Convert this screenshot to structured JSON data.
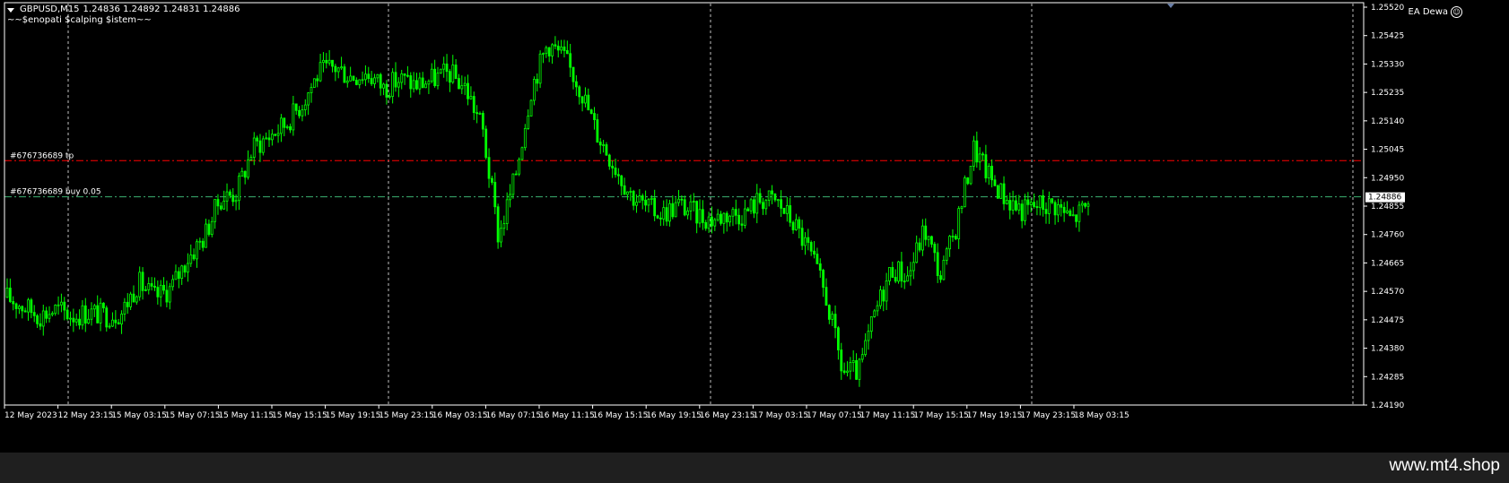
{
  "header": {
    "symbol": "GBPUSD,M15",
    "ohlc": "1.24836 1.24892 1.24831 1.24886",
    "indicator": "~~$enopati $calping $istem~~"
  },
  "ea_label": "EA Dewa",
  "watermark": "www.mt4.shop",
  "orders": {
    "tp_label": "#676736689 tp",
    "tp_price": 1.25007,
    "buy_label": "#676736689 buy 0.05",
    "buy_price": 1.24886
  },
  "colors": {
    "background": "#000000",
    "candles": "#00ff00",
    "tp_line": "#ff0000",
    "order_line": "#3cb371",
    "grid": "#c0c0c0",
    "text": "#ffffff"
  },
  "chart_data": {
    "type": "candlestick",
    "symbol": "GBPUSD",
    "timeframe": "M15",
    "ylim": [
      1.2419,
      1.2552
    ],
    "grid": true,
    "y_ticks": [
      "1.25520",
      "1.25425",
      "1.25330",
      "1.25235",
      "1.25140",
      "1.25045",
      "1.24950",
      "1.24855",
      "1.24760",
      "1.24665",
      "1.24570",
      "1.24475",
      "1.24380",
      "1.24285",
      "1.24190"
    ],
    "current_price": "1.24886",
    "x_ticks": [
      "12 May 2023",
      "12 May 23:15",
      "15 May 03:15",
      "15 May 07:15",
      "15 May 11:15",
      "15 May 15:15",
      "15 May 19:15",
      "15 May 23:15",
      "16 May 03:15",
      "16 May 07:15",
      "16 May 11:15",
      "16 May 15:15",
      "16 May 19:15",
      "16 May 23:15",
      "17 May 03:15",
      "17 May 07:15",
      "17 May 11:15",
      "17 May 15:15",
      "17 May 19:15",
      "17 May 23:15",
      "18 May 03:15"
    ],
    "close_path": [
      [
        0,
        1.2455
      ],
      [
        2,
        1.2452
      ],
      [
        4,
        1.2449
      ],
      [
        6,
        1.2451
      ],
      [
        8,
        1.2449
      ],
      [
        10,
        1.245
      ],
      [
        12,
        1.2449
      ],
      [
        14,
        1.245
      ],
      [
        16,
        1.246
      ],
      [
        18,
        1.2455
      ],
      [
        20,
        1.2458
      ],
      [
        22,
        1.2468
      ],
      [
        24,
        1.2475
      ],
      [
        26,
        1.2488
      ],
      [
        28,
        1.249
      ],
      [
        30,
        1.2505
      ],
      [
        32,
        1.2509
      ],
      [
        34,
        1.2513
      ],
      [
        36,
        1.252
      ],
      [
        38,
        1.253
      ],
      [
        40,
        1.2532
      ],
      [
        42,
        1.2529
      ],
      [
        44,
        1.253
      ],
      [
        46,
        1.2525
      ],
      [
        48,
        1.2528
      ],
      [
        50,
        1.2526
      ],
      [
        52,
        1.2528
      ],
      [
        54,
        1.253
      ],
      [
        56,
        1.2525
      ],
      [
        58,
        1.2512
      ],
      [
        60,
        1.2475
      ],
      [
        62,
        1.2495
      ],
      [
        64,
        1.2525
      ],
      [
        66,
        1.254
      ],
      [
        68,
        1.2535
      ],
      [
        70,
        1.2525
      ],
      [
        72,
        1.251
      ],
      [
        74,
        1.25
      ],
      [
        76,
        1.249
      ],
      [
        78,
        1.2485
      ],
      [
        80,
        1.2483
      ],
      [
        82,
        1.2486
      ],
      [
        84,
        1.2483
      ],
      [
        86,
        1.2481
      ],
      [
        88,
        1.2483
      ],
      [
        90,
        1.2483
      ],
      [
        92,
        1.2488
      ],
      [
        94,
        1.2487
      ],
      [
        96,
        1.248
      ],
      [
        98,
        1.247
      ],
      [
        100,
        1.2455
      ],
      [
        102,
        1.243
      ],
      [
        104,
        1.243
      ],
      [
        106,
        1.245
      ],
      [
        108,
        1.2465
      ],
      [
        110,
        1.2462
      ],
      [
        112,
        1.2478
      ],
      [
        114,
        1.2462
      ],
      [
        116,
        1.248
      ],
      [
        118,
        1.2505
      ],
      [
        120,
        1.2495
      ],
      [
        122,
        1.2488
      ],
      [
        124,
        1.2484
      ],
      [
        126,
        1.2486
      ],
      [
        128,
        1.2486
      ],
      [
        130,
        1.2481
      ],
      [
        132,
        1.2486
      ]
    ]
  }
}
